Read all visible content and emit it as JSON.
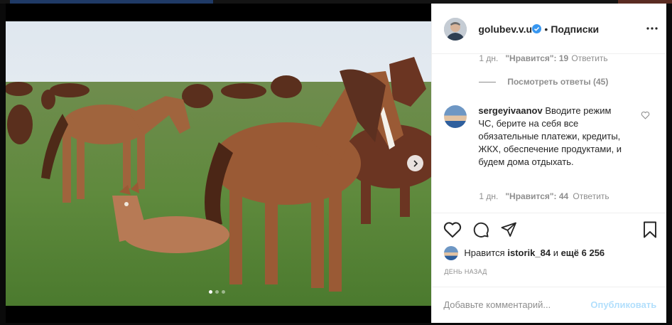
{
  "post": {
    "author": "golubev.v.u",
    "follow_separator": "•",
    "follow_label": "Подписки"
  },
  "thread": {
    "prev_reply_meta": {
      "time": "1 дн.",
      "likes": "\"Нравится\": 19",
      "reply": "Ответить"
    },
    "view_replies": "Посмотреть ответы (45)",
    "comment": {
      "user": "sergeyivaanov",
      "text": "Вводите режим ЧС, берите на себя все обязательные платежи, кредиты, ЖКХ, обеспечение продуктами, и будем дома отдыхать.",
      "time": "1 дн.",
      "likes": "\"Нравится\": 44",
      "reply": "Ответить"
    }
  },
  "likes": {
    "prefix": "Нравится",
    "user": "istorik_84",
    "connector": "и",
    "others": "ещё 6 256"
  },
  "timestamp": "ДЕНЬ НАЗАД",
  "comment_box": {
    "placeholder": "Добавьте комментарий...",
    "post_label": "Опубликовать"
  },
  "carousel": {
    "total": 3,
    "current": 1
  },
  "icons": {
    "verified": "verified-badge-icon",
    "more": "more-options-icon",
    "like": "heart-icon",
    "comment": "comment-bubble-icon",
    "share": "paper-plane-icon",
    "save": "bookmark-icon",
    "next": "chevron-right-icon"
  },
  "colors": {
    "text": "#262626",
    "secondary": "#8e8e8e",
    "verified_blue": "#3897f0",
    "post_disabled": "#b2dffc",
    "divider": "#efefef"
  }
}
